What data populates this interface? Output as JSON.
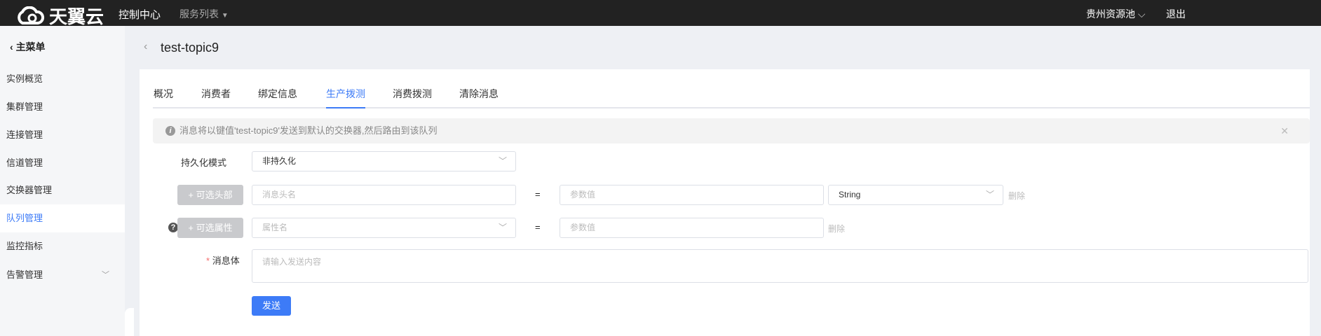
{
  "topbar": {
    "brand": "天翼云",
    "console": "控制中心",
    "services": "服务列表",
    "region": "贵州资源池",
    "logout": "退出"
  },
  "sidebar": {
    "back_label": "主菜单",
    "items": [
      {
        "label": "实例概览"
      },
      {
        "label": "集群管理"
      },
      {
        "label": "连接管理"
      },
      {
        "label": "信道管理"
      },
      {
        "label": "交换器管理"
      },
      {
        "label": "队列管理",
        "active": true
      },
      {
        "label": "监控指标"
      },
      {
        "label": "告警管理"
      }
    ]
  },
  "page": {
    "title": "test-topic9"
  },
  "tabs": [
    {
      "label": "概况"
    },
    {
      "label": "消费者"
    },
    {
      "label": "绑定信息"
    },
    {
      "label": "生产拨测",
      "active": true
    },
    {
      "label": "消费拨测"
    },
    {
      "label": "清除消息"
    }
  ],
  "alert": {
    "text": "消息将以键值'test-topic9'发送到默认的交换器,然后路由到该队列"
  },
  "form": {
    "persistence_label": "持久化模式",
    "persistence_value": "非持久化",
    "header_button": "+ 可选头部",
    "header_name_placeholder": "消息头名",
    "equals": "=",
    "param_value_placeholder": "参数值",
    "type_value": "String",
    "delete": "删除",
    "property_button": "+ 可选属性",
    "property_name_placeholder": "属性名",
    "body_required": "*",
    "body_label": "消息体",
    "body_placeholder": "请输入发送内容",
    "send_button": "发送"
  },
  "colors": {
    "accent": "#3d7bf7",
    "topbar": "#222222"
  }
}
